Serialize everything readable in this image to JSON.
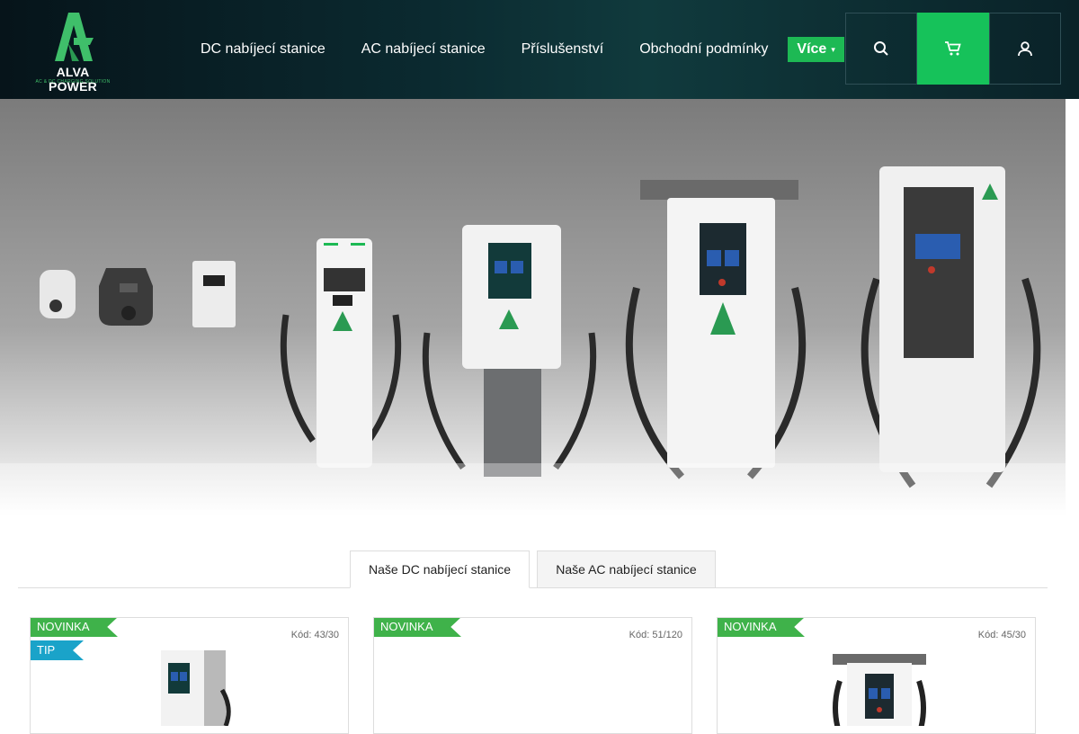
{
  "brand": {
    "logo_text": "ALVA POWER",
    "logo_sub": "AC & DC CHARGING SOLUTION",
    "accent": "#16c25a"
  },
  "nav": {
    "items": [
      {
        "label": "DC nabíjecí stanice"
      },
      {
        "label": "AC nabíjecí stanice"
      },
      {
        "label": "Příslušenství"
      },
      {
        "label": "Obchodní podmínky"
      }
    ],
    "more_label": "Více",
    "icons": [
      "search-icon",
      "cart-icon",
      "user-icon"
    ]
  },
  "hero": {
    "alt": "Charging stations lineup"
  },
  "tabs": [
    {
      "label": "Naše DC nabíjecí stanice",
      "active": true
    },
    {
      "label": "Naše AC nabíjecí stanice",
      "active": false
    }
  ],
  "products": [
    {
      "badges": [
        "NOVINKA",
        "TIP"
      ],
      "code": "Kód: 43/30"
    },
    {
      "badges": [
        "NOVINKA"
      ],
      "code": "Kód: 51/120"
    },
    {
      "badges": [
        "NOVINKA"
      ],
      "code": "Kód: 45/30"
    }
  ]
}
